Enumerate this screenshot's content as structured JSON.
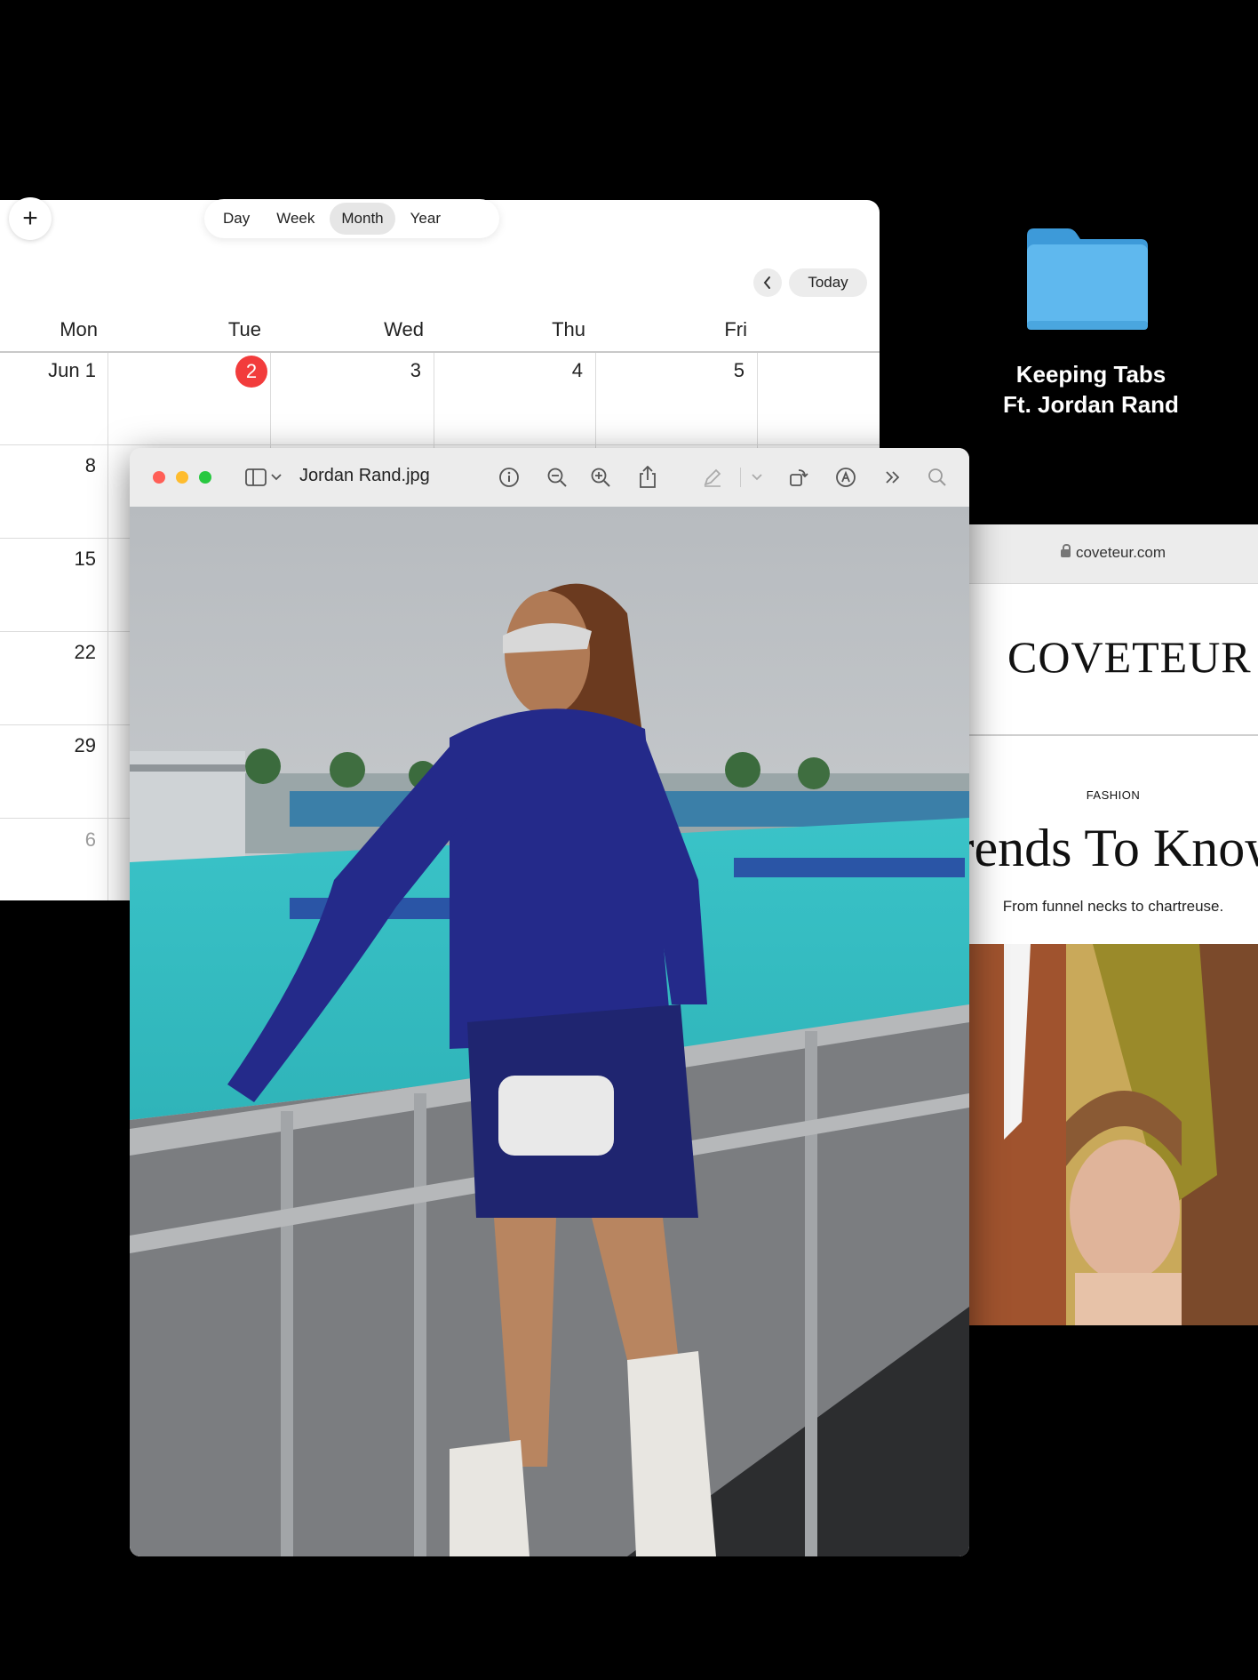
{
  "calendar": {
    "views": [
      "Day",
      "Week",
      "Month",
      "Year"
    ],
    "active_view": "Month",
    "today_label": "Today",
    "weekdays": [
      "Mon",
      "Tue",
      "Wed",
      "Thu",
      "Fri"
    ],
    "week1": [
      "Jun 1",
      "2",
      "3",
      "4",
      "5"
    ],
    "week_start_dates": [
      "8",
      "15",
      "22",
      "29",
      "6"
    ],
    "today_date": "2"
  },
  "folder": {
    "label_line1": "Keeping Tabs",
    "label_line2": "Ft. Jordan Rand",
    "color": "#5fb8ee"
  },
  "browser": {
    "url": "coveteur.com",
    "logo": "COVETEUR",
    "category": "FASHION",
    "headline": "Trends To Know",
    "subhead": "From funnel necks to chartreuse."
  },
  "preview": {
    "title": "Jordan Rand.jpg",
    "toolbar_icons": [
      "sidebar-icon",
      "chevron-down-icon",
      "info-icon",
      "zoom-out-icon",
      "zoom-in-icon",
      "share-icon",
      "markup-pen-icon",
      "chevron-down-icon",
      "rotate-icon",
      "annotate-icon",
      "more-icon",
      "search-icon"
    ]
  }
}
